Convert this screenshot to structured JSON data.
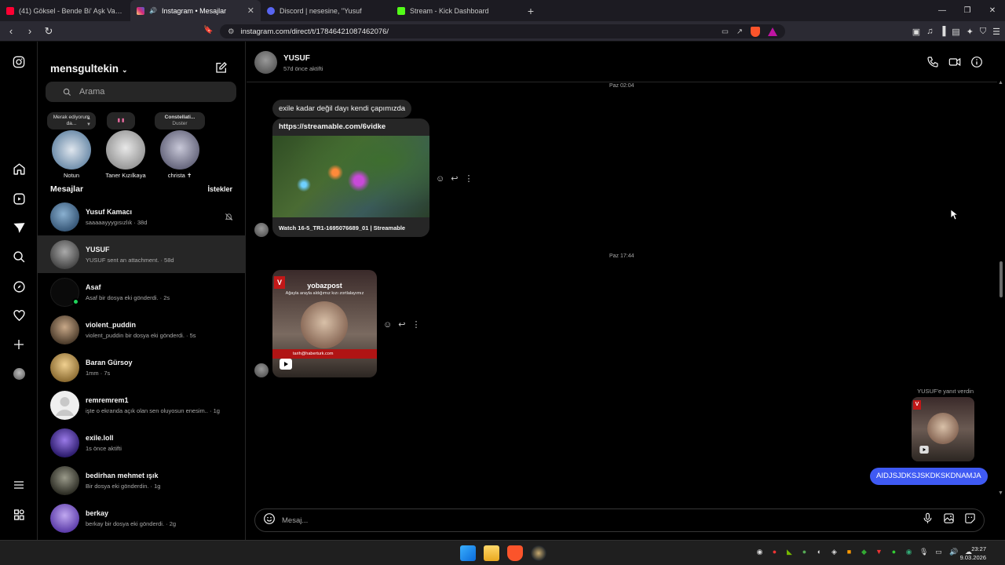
{
  "browser": {
    "tabs": [
      {
        "title": "(41) Göksel - Bende Bi' Aşk Var (Full A",
        "icon_color": "#ff0033",
        "active": false
      },
      {
        "title": "Instagram • Mesajlar",
        "icon_color": "#e1306c",
        "active": true
      },
      {
        "title": "Discord | nesesine, \"Yusuf",
        "icon_color": "#5865f2",
        "active": false
      },
      {
        "title": "Stream - Kick Dashboard",
        "icon_color": "#53fc18",
        "active": false
      }
    ],
    "url": "instagram.com/direct/t/17846421087462076/"
  },
  "sidebar": {
    "username": "mensgultekin",
    "search_placeholder": "Arama",
    "notes": [
      {
        "note_text": "Merak ediyorum da...",
        "label": "Notun"
      },
      {
        "note_text": "▮ ▮",
        "label": "Taner Kızılkaya"
      },
      {
        "note_text": "Constellati...",
        "note_sub": "Duster",
        "label": "christa ✝"
      }
    ],
    "messages_heading": "Mesajlar",
    "requests_label": "İstekler",
    "conversations": [
      {
        "name": "Yusuf Kamacı",
        "preview": "saaaaayyygısızlık · 38d",
        "muted": true,
        "color": "#4a6a8a"
      },
      {
        "name": "YUSUF",
        "preview": "YUSUF sent an attachment. · 58d",
        "selected": true,
        "color": "#888888"
      },
      {
        "name": "Asaf",
        "preview": "Asaf bir dosya eki gönderdi. · 2s",
        "online": true,
        "color": "#0a0a0a"
      },
      {
        "name": "violent_puddin",
        "preview": "violent_puddin bir dosya eki gönderdi. · 5s",
        "color": "#6a5a4a"
      },
      {
        "name": "Baran Gürsoy",
        "preview": "1mm · 7s",
        "color": "#c8a060"
      },
      {
        "name": "remremrem1",
        "preview": "işte o ekranda açık olan sen oluyosun enesim.. · 1g",
        "color": "#e8e8e8"
      },
      {
        "name": "exile.loll",
        "preview": "1s önce aktifti",
        "color": "#5a3ac8"
      },
      {
        "name": "bedirhan mehmet ışık",
        "preview": "Bir dosya eki gönderdin. · 1g",
        "color": "#5a5a4a"
      },
      {
        "name": "berkay",
        "preview": "berkay bir dosya eki gönderdi. · 2g",
        "color": "#8a6ad8"
      }
    ]
  },
  "chat": {
    "name": "YUSUF",
    "status": "57d önce aktifti",
    "timestamp_1": "Paz 02:04",
    "message_1": "exile kadar değil dayı kendi çapımızda",
    "link_url": "https://streamable.com/6vidke",
    "link_caption": "Watch 16-5_TR1-1695076689_01 | Streamable",
    "timestamp_2": "Paz 17:44",
    "reel_account": "yobazpost",
    "reel_text": "Ağayla arayla aldığımız kızı zortlalayımız",
    "reel_banner": "tarih@haberturk.com",
    "reply_label": "YUSUF'e yanıt verdin",
    "sent_message": "AIDJSJDKSJSKDKSKDNAMJA",
    "composer_placeholder": "Mesaj..."
  },
  "taskbar": {
    "time": "23:27",
    "date": "9.03.2026"
  }
}
